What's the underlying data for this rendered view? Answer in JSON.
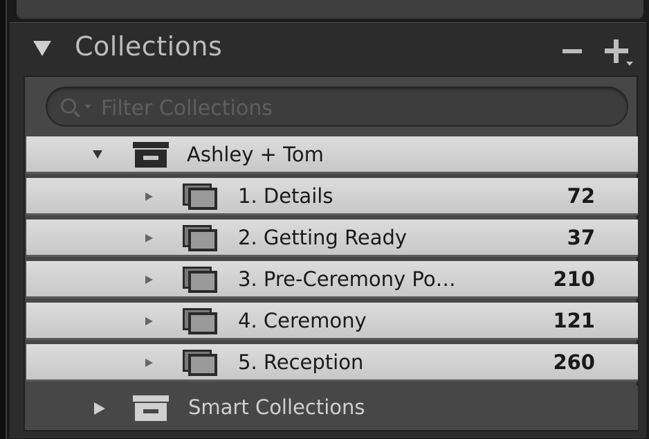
{
  "panel": {
    "title": "Collections",
    "remove_icon": "minus-icon",
    "add_icon": "plus-icon"
  },
  "filter": {
    "placeholder": "Filter Collections",
    "icon": "search-icon"
  },
  "collection_set": {
    "label": "Ashley + Tom",
    "expanded": true,
    "icon": "collection-set-icon"
  },
  "collections": [
    {
      "label": "1. Details",
      "count": "72"
    },
    {
      "label": "2. Getting Ready",
      "count": "37"
    },
    {
      "label": "3. Pre-Ceremony Po…",
      "count": "210"
    },
    {
      "label": "4. Ceremony",
      "count": "121"
    },
    {
      "label": "5. Reception",
      "count": "260"
    }
  ],
  "smart_collections": {
    "label": "Smart Collections",
    "expanded": false
  },
  "colors": {
    "panel_bg": "#2c2c2c",
    "content_bg": "#474747",
    "row_selected": "#d4d4d4",
    "header_text": "#bdbdbd"
  }
}
